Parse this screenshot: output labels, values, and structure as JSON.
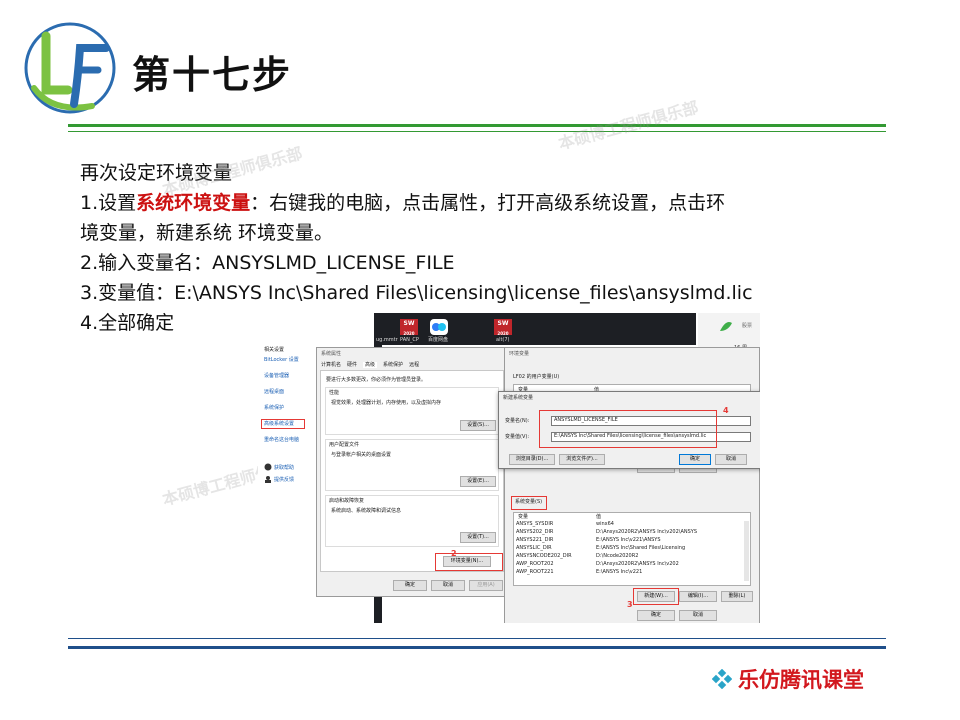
{
  "header": {
    "logo_text": "LF",
    "title": "第十七步"
  },
  "content": {
    "line1": "再次设定环境变量",
    "line2_prefix": "1.设置",
    "line2_highlight": "系统环境变量",
    "line2_suffix": "：右键我的电脑，点击属性，打开高级系统设置，点击环",
    "line3": "境变量，新建系统 环境变量。",
    "line4": "2.输入变量名：ANSYSLMD_LICENSE_FILE",
    "line5": "3.变量值：E:\\ANSYS Inc\\Shared Files\\licensing\\license_files\\ansyslmd.lic",
    "line6": "4.全部确定"
  },
  "watermark": "本硕博工程师俱乐部",
  "screenshot": {
    "taskbar": {
      "icons": [
        {
          "label": "ug.mmtr"
        },
        {
          "label": "PAN_CP"
        },
        {
          "label": "百度网盘"
        },
        {
          "label": "alt(7)"
        }
      ],
      "sw_label": "SW",
      "sw_year": "2020",
      "right_text": "16 周",
      "right_text2": "股票"
    },
    "left_panel": {
      "heading": "相关设置",
      "links": [
        "BitLocker 设置",
        "设备管理器",
        "远程桌面",
        "系统保护",
        "高级系统设置",
        "重命名这台电脑"
      ],
      "help": [
        "获取帮助",
        "提供反馈"
      ]
    },
    "sysprops": {
      "title": "系统属性",
      "tabs": [
        "计算机名",
        "硬件",
        "高级",
        "系统保护",
        "远程"
      ],
      "admin_note": "要进行大多数更改，你必须作为管理员登录。",
      "perf_title": "性能",
      "perf_desc": "视觉效果，处理器计划，内存使用，以及虚拟内存",
      "settings_btn": "设置(S)...",
      "profile_title": "用户配置文件",
      "profile_desc": "与登录帐户相关的桌面设置",
      "settings_btn2": "设置(E)...",
      "startup_title": "启动和故障恢复",
      "startup_desc": "系统启动、系统故障和调试信息",
      "settings_btn3": "设置(T)...",
      "env_btn": "环境变量(N)...",
      "ok": "确定",
      "cancel": "取消",
      "apply": "应用(A)",
      "step_num": "2"
    },
    "envvars": {
      "title": "环境变量",
      "user_vars_label": "LF02 的用户变量(U)",
      "col_var": "变量",
      "col_val": "值",
      "user_new_btn": "新建(N)...",
      "user_edit_btn": "编辑",
      "sys_vars_label": "系统变量(S)",
      "rows": [
        {
          "name": "ANSYS_SYSDIR",
          "value": "winx64"
        },
        {
          "name": "ANSYS202_DIR",
          "value": "D:\\Ansys2020R2\\ANSYS Inc\\v202\\ANSYS"
        },
        {
          "name": "ANSYS221_DIR",
          "value": "E:\\ANSYS Inc\\v221\\ANSYS"
        },
        {
          "name": "ANSYSLIC_DIR",
          "value": "E:\\ANSYS Inc\\Shared Files\\Licensing"
        },
        {
          "name": "ANSYSNCODE202_DIR",
          "value": "D:\\Ncode2020R2"
        },
        {
          "name": "AWP_ROOT202",
          "value": "D:\\Ansys2020R2\\ANSYS Inc\\v202"
        },
        {
          "name": "AWP_ROOT221",
          "value": "E:\\ANSYS Inc\\v221"
        }
      ],
      "new_btn": "新建(W)...",
      "edit_btn": "编辑(I)...",
      "delete_btn": "删除(L)",
      "ok": "确定",
      "cancel": "取消",
      "step_num": "3"
    },
    "newvar": {
      "title": "新建系统变量",
      "name_label": "变量名(N):",
      "name_value": "ANSYSLMD_LICENSE_FILE",
      "value_label": "变量值(V):",
      "value_value": "E:\\ANSYS Inc\\Shared Files\\licensing\\license_files\\ansyslmd.lic",
      "browse_dir": "浏览目录(D)...",
      "browse_file": "浏览文件(F)...",
      "ok": "确定",
      "cancel": "取消",
      "step_num": "4"
    }
  },
  "footer": {
    "brand": "乐仿腾讯课堂"
  },
  "colors": {
    "green_rule": "#339933",
    "blue_rule": "#1f4f8a",
    "highlight_red": "#cc1111",
    "step_red": "#e53935"
  }
}
